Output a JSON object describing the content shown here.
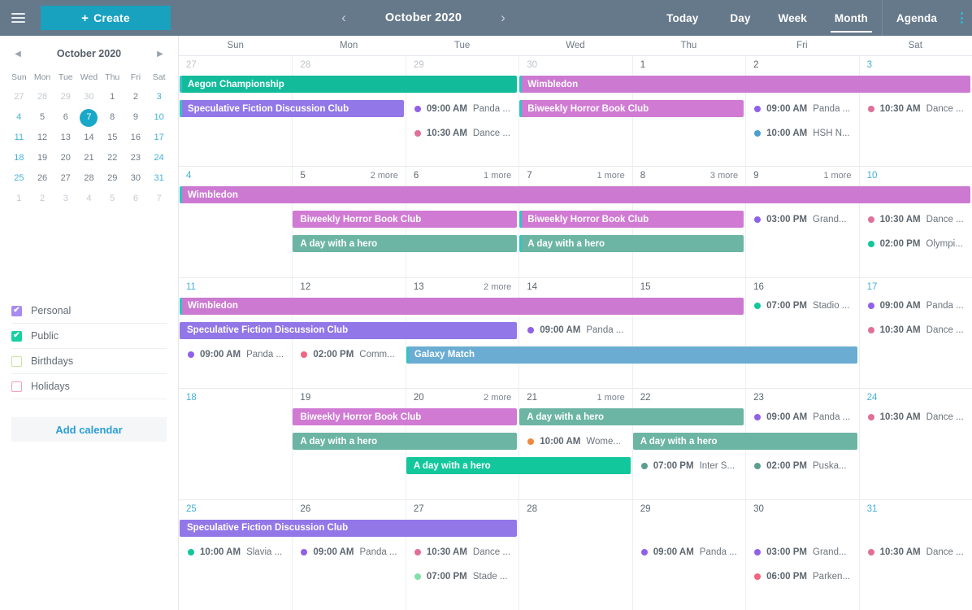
{
  "topbar": {
    "menu_icon": "hamburger-icon",
    "create_label": "Create",
    "create_plus": "+",
    "prev_icon": "‹",
    "next_icon": "›",
    "title": "October 2020",
    "today_label": "Today",
    "day_label": "Day",
    "week_label": "Week",
    "month_label": "Month",
    "agenda_label": "Agenda",
    "kebab_icon": "more-vertical-icon",
    "accent": "#19a1c0",
    "bg": "#66798a"
  },
  "sidebar": {
    "mini": {
      "title": "October 2020",
      "prev_icon": "◀",
      "next_icon": "▶",
      "dow": [
        "Sun",
        "Mon",
        "Tue",
        "Wed",
        "Thu",
        "Fri",
        "Sat"
      ],
      "weeks": [
        [
          {
            "n": "27",
            "state": "out"
          },
          {
            "n": "28",
            "state": "out"
          },
          {
            "n": "29",
            "state": "out"
          },
          {
            "n": "30",
            "state": "out"
          },
          {
            "n": "1",
            "state": "normal"
          },
          {
            "n": "2",
            "state": "normal"
          },
          {
            "n": "3",
            "state": "weekend"
          }
        ],
        [
          {
            "n": "4",
            "state": "weekend"
          },
          {
            "n": "5",
            "state": "normal"
          },
          {
            "n": "6",
            "state": "normal"
          },
          {
            "n": "7",
            "state": "selected"
          },
          {
            "n": "8",
            "state": "normal"
          },
          {
            "n": "9",
            "state": "normal"
          },
          {
            "n": "10",
            "state": "weekend"
          }
        ],
        [
          {
            "n": "11",
            "state": "weekend"
          },
          {
            "n": "12",
            "state": "normal"
          },
          {
            "n": "13",
            "state": "normal"
          },
          {
            "n": "14",
            "state": "normal"
          },
          {
            "n": "15",
            "state": "normal"
          },
          {
            "n": "16",
            "state": "normal"
          },
          {
            "n": "17",
            "state": "weekend"
          }
        ],
        [
          {
            "n": "18",
            "state": "weekend"
          },
          {
            "n": "19",
            "state": "normal"
          },
          {
            "n": "20",
            "state": "normal"
          },
          {
            "n": "21",
            "state": "normal"
          },
          {
            "n": "22",
            "state": "normal"
          },
          {
            "n": "23",
            "state": "normal"
          },
          {
            "n": "24",
            "state": "weekend"
          }
        ],
        [
          {
            "n": "25",
            "state": "weekend"
          },
          {
            "n": "26",
            "state": "normal"
          },
          {
            "n": "27",
            "state": "normal"
          },
          {
            "n": "28",
            "state": "normal"
          },
          {
            "n": "29",
            "state": "normal"
          },
          {
            "n": "30",
            "state": "normal"
          },
          {
            "n": "31",
            "state": "weekend"
          }
        ],
        [
          {
            "n": "1",
            "state": "out"
          },
          {
            "n": "2",
            "state": "out"
          },
          {
            "n": "3",
            "state": "out"
          },
          {
            "n": "4",
            "state": "out"
          },
          {
            "n": "5",
            "state": "out"
          },
          {
            "n": "6",
            "state": "out"
          },
          {
            "n": "7",
            "state": "out"
          }
        ]
      ],
      "selected_day": "7"
    },
    "calendars": [
      {
        "label": "Personal",
        "color": "#a78bf0",
        "checked": true
      },
      {
        "label": "Public",
        "color": "#19d0a0",
        "checked": true
      },
      {
        "label": "Birthdays",
        "color": "#c6e79a",
        "checked": false
      },
      {
        "label": "Holidays",
        "color": "#f2a0b4",
        "checked": false
      }
    ],
    "add_calendar_label": "Add calendar",
    "check_glyph": "✔"
  },
  "grid": {
    "dow": [
      "Sun",
      "Mon",
      "Tue",
      "Wed",
      "Thu",
      "Fri",
      "Sat"
    ],
    "weeks": [
      {
        "days": [
          {
            "n": "27",
            "state": "out",
            "more": ""
          },
          {
            "n": "28",
            "state": "out",
            "more": ""
          },
          {
            "n": "29",
            "state": "out",
            "more": ""
          },
          {
            "n": "30",
            "state": "out",
            "more": ""
          },
          {
            "n": "1",
            "state": "normal",
            "more": ""
          },
          {
            "n": "2",
            "state": "normal",
            "more": ""
          },
          {
            "n": "3",
            "state": "weekend",
            "more": ""
          }
        ],
        "bars": [
          {
            "title": "Aegon Championship",
            "start": 0,
            "span": 3,
            "row": 0,
            "color": "#12bc9b",
            "cont_left": true
          },
          {
            "title": "Wimbledon",
            "start": 3,
            "span": 4,
            "row": 0,
            "color": "#cc79d2",
            "cont_left": true
          },
          {
            "title": "Speculative Fiction Discussion Club",
            "start": 0,
            "span": 2,
            "row": 1,
            "color": "#9277e8",
            "cont_left": true
          },
          {
            "title": "Biweekly Horror Book Club",
            "start": 3,
            "span": 2,
            "row": 1,
            "color": "#d07ad4",
            "cont_left": true
          }
        ],
        "timed": [
          {
            "day": 2,
            "row": 1,
            "time": "09:00 AM",
            "title": "Panda ...",
            "color": "#9160e8"
          },
          {
            "day": 2,
            "row": 2,
            "time": "10:30 AM",
            "title": "Dance ...",
            "color": "#e0709a"
          },
          {
            "day": 5,
            "row": 1,
            "time": "09:00 AM",
            "title": "Panda ...",
            "color": "#9160e8"
          },
          {
            "day": 5,
            "row": 2,
            "time": "10:00 AM",
            "title": "HSH N...",
            "color": "#4c9fd0"
          },
          {
            "day": 6,
            "row": 1,
            "time": "10:30 AM",
            "title": "Dance ...",
            "color": "#e0709a"
          }
        ]
      },
      {
        "days": [
          {
            "n": "4",
            "state": "weekend",
            "more": ""
          },
          {
            "n": "5",
            "state": "normal",
            "more": "2 more"
          },
          {
            "n": "6",
            "state": "normal",
            "more": "1 more"
          },
          {
            "n": "7",
            "state": "normal",
            "more": "1 more"
          },
          {
            "n": "8",
            "state": "normal",
            "more": "3 more"
          },
          {
            "n": "9",
            "state": "normal",
            "more": "1 more"
          },
          {
            "n": "10",
            "state": "weekend",
            "more": ""
          }
        ],
        "bars": [
          {
            "title": "Wimbledon",
            "start": 0,
            "span": 7,
            "row": 0,
            "color": "#cc79d2",
            "cont_left": true
          },
          {
            "title": "Biweekly Horror Book Club",
            "start": 1,
            "span": 2,
            "row": 1,
            "color": "#d07ad4",
            "cont_left": false
          },
          {
            "title": "Biweekly Horror Book Club",
            "start": 3,
            "span": 2,
            "row": 1,
            "color": "#d07ad4",
            "cont_left": true
          },
          {
            "title": "A day with a hero",
            "start": 1,
            "span": 2,
            "row": 2,
            "color": "#6cb5a4",
            "cont_left": false
          },
          {
            "title": "A day with a hero",
            "start": 3,
            "span": 2,
            "row": 2,
            "color": "#6cb5a4",
            "cont_left": true
          }
        ],
        "timed": [
          {
            "day": 5,
            "row": 1,
            "time": "03:00 PM",
            "title": "Grand...",
            "color": "#9160e8"
          },
          {
            "day": 6,
            "row": 1,
            "time": "10:30 AM",
            "title": "Dance ...",
            "color": "#e0709a"
          },
          {
            "day": 6,
            "row": 2,
            "time": "02:00 PM",
            "title": "Olympi...",
            "color": "#12c79c"
          }
        ]
      },
      {
        "days": [
          {
            "n": "11",
            "state": "weekend",
            "more": ""
          },
          {
            "n": "12",
            "state": "normal",
            "more": ""
          },
          {
            "n": "13",
            "state": "normal",
            "more": "2 more"
          },
          {
            "n": "14",
            "state": "normal",
            "more": ""
          },
          {
            "n": "15",
            "state": "normal",
            "more": ""
          },
          {
            "n": "16",
            "state": "normal",
            "more": ""
          },
          {
            "n": "17",
            "state": "weekend",
            "more": ""
          }
        ],
        "bars": [
          {
            "title": "Wimbledon",
            "start": 0,
            "span": 5,
            "row": 0,
            "color": "#cc79d2",
            "cont_left": true
          },
          {
            "title": "Speculative Fiction Discussion Club",
            "start": 0,
            "span": 3,
            "row": 1,
            "color": "#9277e8",
            "cont_left": false
          },
          {
            "title": "Galaxy Match",
            "start": 2,
            "span": 4,
            "row": 2,
            "color": "#6aacd2",
            "cont_left": true
          }
        ],
        "timed": [
          {
            "day": 0,
            "row": 2,
            "time": "09:00 AM",
            "title": "Panda ...",
            "color": "#9160e8"
          },
          {
            "day": 1,
            "row": 2,
            "time": "02:00 PM",
            "title": "Comm...",
            "color": "#f2657e"
          },
          {
            "day": 3,
            "row": 1,
            "time": "09:00 AM",
            "title": "Panda ...",
            "color": "#9160e8"
          },
          {
            "day": 5,
            "row": 0,
            "time": "07:00 PM",
            "title": "Stadio ...",
            "color": "#12c79c"
          },
          {
            "day": 6,
            "row": 0,
            "time": "09:00 AM",
            "title": "Panda ...",
            "color": "#9160e8"
          },
          {
            "day": 6,
            "row": 1,
            "time": "10:30 AM",
            "title": "Dance ...",
            "color": "#e0709a"
          }
        ]
      },
      {
        "days": [
          {
            "n": "18",
            "state": "weekend",
            "more": ""
          },
          {
            "n": "19",
            "state": "normal",
            "more": ""
          },
          {
            "n": "20",
            "state": "normal",
            "more": "2 more"
          },
          {
            "n": "21",
            "state": "normal",
            "more": "1 more"
          },
          {
            "n": "22",
            "state": "normal",
            "more": ""
          },
          {
            "n": "23",
            "state": "normal",
            "more": ""
          },
          {
            "n": "24",
            "state": "weekend",
            "more": ""
          }
        ],
        "bars": [
          {
            "title": "Biweekly Horror Book Club",
            "start": 1,
            "span": 2,
            "row": 0,
            "color": "#d07ad4",
            "cont_left": false
          },
          {
            "title": "A day with a hero",
            "start": 3,
            "span": 2,
            "row": 0,
            "color": "#6cb5a4",
            "cont_left": false
          },
          {
            "title": "A day with a hero",
            "start": 1,
            "span": 2,
            "row": 1,
            "color": "#6cb5a4",
            "cont_left": false
          },
          {
            "title": "A day with a hero",
            "start": 2,
            "span": 2,
            "row": 2,
            "color": "#12c79c",
            "cont_left": false
          },
          {
            "title": "A day with a hero",
            "start": 4,
            "span": 2,
            "row": 1,
            "color": "#6cb5a4",
            "cont_left": false
          }
        ],
        "timed": [
          {
            "day": 3,
            "row": 1,
            "time": "10:00 AM",
            "title": "Wome...",
            "color": "#f0893f"
          },
          {
            "day": 4,
            "row": 2,
            "time": "07:00 PM",
            "title": "Inter S...",
            "color": "#5b9e90"
          },
          {
            "day": 5,
            "row": 0,
            "time": "09:00 AM",
            "title": "Panda ...",
            "color": "#9160e8"
          },
          {
            "day": 5,
            "row": 2,
            "time": "02:00 PM",
            "title": "Puska...",
            "color": "#5b9e90"
          },
          {
            "day": 6,
            "row": 0,
            "time": "10:30 AM",
            "title": "Dance ...",
            "color": "#e0709a"
          }
        ]
      },
      {
        "days": [
          {
            "n": "25",
            "state": "weekend",
            "more": ""
          },
          {
            "n": "26",
            "state": "normal",
            "more": ""
          },
          {
            "n": "27",
            "state": "normal",
            "more": ""
          },
          {
            "n": "28",
            "state": "normal",
            "more": ""
          },
          {
            "n": "29",
            "state": "normal",
            "more": ""
          },
          {
            "n": "30",
            "state": "normal",
            "more": ""
          },
          {
            "n": "31",
            "state": "weekend",
            "more": ""
          }
        ],
        "bars": [
          {
            "title": "Speculative Fiction Discussion Club",
            "start": 0,
            "span": 3,
            "row": 0,
            "color": "#9277e8",
            "cont_left": false
          }
        ],
        "timed": [
          {
            "day": 0,
            "row": 1,
            "time": "10:00 AM",
            "title": "Slavia ...",
            "color": "#12c79c"
          },
          {
            "day": 1,
            "row": 1,
            "time": "09:00 AM",
            "title": "Panda ...",
            "color": "#9160e8"
          },
          {
            "day": 2,
            "row": 1,
            "time": "10:30 AM",
            "title": "Dance ...",
            "color": "#e0709a"
          },
          {
            "day": 2,
            "row": 2,
            "time": "07:00 PM",
            "title": "Stade ...",
            "color": "#7fe0a8"
          },
          {
            "day": 4,
            "row": 1,
            "time": "09:00 AM",
            "title": "Panda ...",
            "color": "#9160e8"
          },
          {
            "day": 5,
            "row": 1,
            "time": "03:00 PM",
            "title": "Grand...",
            "color": "#9160e8"
          },
          {
            "day": 5,
            "row": 2,
            "time": "06:00 PM",
            "title": "Parken...",
            "color": "#f2657e"
          },
          {
            "day": 6,
            "row": 1,
            "time": "10:30 AM",
            "title": "Dance ...",
            "color": "#e0709a"
          }
        ]
      }
    ]
  }
}
